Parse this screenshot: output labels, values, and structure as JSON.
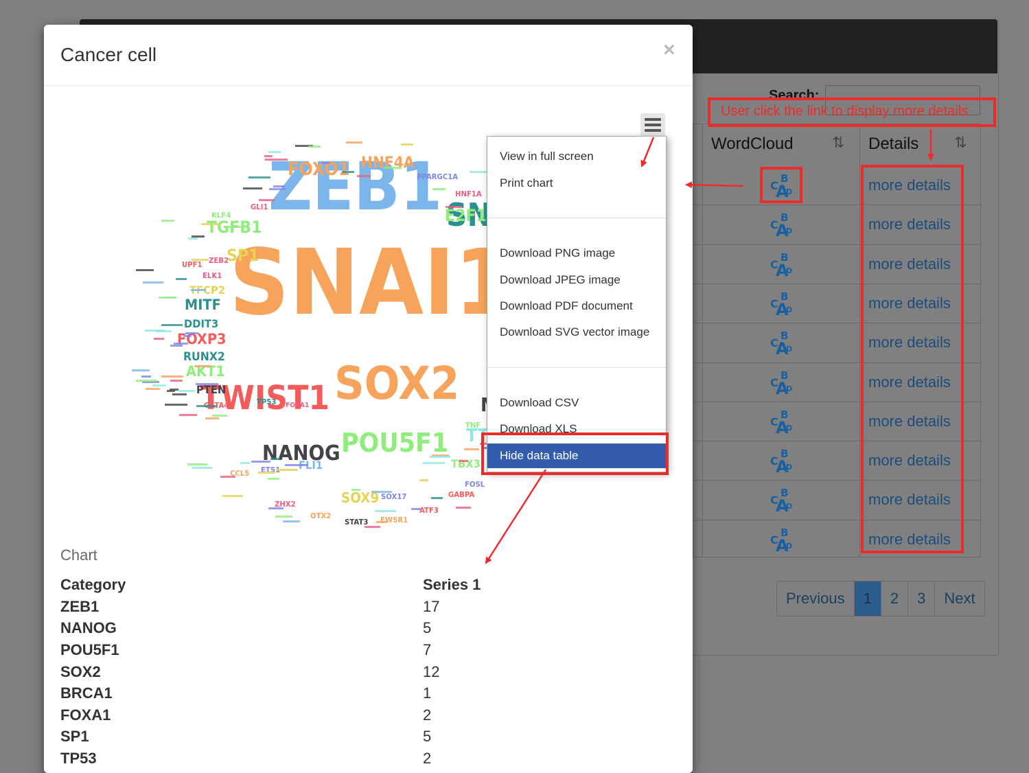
{
  "background": {
    "search_label": "Search:",
    "table": {
      "headers": [
        "WordCloud",
        "Details"
      ],
      "sort_icon": "⇅",
      "rows": [
        {
          "details": "more details"
        },
        {
          "details": "more details"
        },
        {
          "details": "more details"
        },
        {
          "details": "more details"
        },
        {
          "details": "more details"
        },
        {
          "details": "more details"
        },
        {
          "details": "more details"
        },
        {
          "details": "more details"
        },
        {
          "details": "more details"
        },
        {
          "details": "more details"
        }
      ]
    },
    "pagination": [
      "Previous",
      "1",
      "2",
      "3",
      "Next"
    ],
    "active_page": "1"
  },
  "modal": {
    "title": "Cancer cell",
    "close": "×",
    "chart_caption": "Chart",
    "table_headers": [
      "Category",
      "Series 1"
    ],
    "table_rows": [
      [
        "ZEB1",
        "17"
      ],
      [
        "NANOG",
        "5"
      ],
      [
        "POU5F1",
        "7"
      ],
      [
        "SOX2",
        "12"
      ],
      [
        "BRCA1",
        "1"
      ],
      [
        "FOXA1",
        "2"
      ],
      [
        "SP1",
        "5"
      ],
      [
        "TP53",
        "2"
      ]
    ]
  },
  "menu": {
    "items": [
      "View in full screen",
      "Print chart",
      "Download PNG image",
      "Download JPEG image",
      "Download PDF document",
      "Download SVG vector image",
      "Download CSV",
      "Download XLS",
      "Hide data table"
    ]
  },
  "annotation": "User click the link to display more details",
  "colors": {
    "accent_blue": "#7cb5ec",
    "orange": "#f7a35c",
    "red": "#f15c80",
    "green": "#90ed7d",
    "teal": "#2b908f",
    "highlight": "#335cad",
    "annotation_red": "#ee2b2b"
  },
  "chart_data": {
    "type": "wordcloud",
    "words": [
      {
        "text": "SNAI1",
        "color": "#f7a35c"
      },
      {
        "text": "ZEB1",
        "color": "#7cb5ec"
      },
      {
        "text": "SOX2",
        "color": "#f7a35c"
      },
      {
        "text": "TWIST1",
        "color": "#f45b5b"
      },
      {
        "text": "POU5F1",
        "color": "#90ed7d"
      },
      {
        "text": "SN",
        "color": "#2b908f"
      },
      {
        "text": "NANOG",
        "color": "#434348"
      },
      {
        "text": "FOXO1",
        "color": "#f7a35c"
      },
      {
        "text": "HNF4A",
        "color": "#f7a35c"
      },
      {
        "text": "TGFB1",
        "color": "#90ed7d"
      },
      {
        "text": "E2F1",
        "color": "#90ed7d"
      },
      {
        "text": "MITF",
        "color": "#2b908f"
      },
      {
        "text": "FOXP3",
        "color": "#f45b5b"
      },
      {
        "text": "SP1",
        "color": "#e4d354"
      },
      {
        "text": "AKT1",
        "color": "#90ed7d"
      },
      {
        "text": "RUNX2",
        "color": "#2b908f"
      },
      {
        "text": "DDIT3",
        "color": "#2b908f"
      },
      {
        "text": "TFCP2",
        "color": "#e4d354"
      },
      {
        "text": "SOX9",
        "color": "#e4d354"
      },
      {
        "text": "PTEN",
        "color": "#434348"
      },
      {
        "text": "FLI1",
        "color": "#7cb5ec"
      },
      {
        "text": "TBX3",
        "color": "#90ed7d"
      },
      {
        "text": "TT",
        "color": "#91e8e1"
      },
      {
        "text": "M",
        "color": "#434348"
      },
      {
        "text": "PPARGC1A",
        "color": "#8085e9"
      },
      {
        "text": "HNF1A",
        "color": "#f15c80"
      },
      {
        "text": "KLF4",
        "color": "#90ed7d"
      },
      {
        "text": "GLI1",
        "color": "#f15c80"
      },
      {
        "text": "ELK1",
        "color": "#f15c80"
      },
      {
        "text": "UPF1",
        "color": "#f45b5b"
      },
      {
        "text": "ZEB2",
        "color": "#f15c80"
      },
      {
        "text": "GATA4",
        "color": "#f45b5b"
      },
      {
        "text": "TP53",
        "color": "#2b908f"
      },
      {
        "text": "FOXA1",
        "color": "#f15c80"
      },
      {
        "text": "TNF",
        "color": "#90ed7d"
      },
      {
        "text": "FOSL",
        "color": "#8085e9"
      },
      {
        "text": "GABPA",
        "color": "#f45b5b"
      },
      {
        "text": "CCL5",
        "color": "#f7a35c"
      },
      {
        "text": "ETS1",
        "color": "#8085e9"
      },
      {
        "text": "ZHX2",
        "color": "#f15c80"
      },
      {
        "text": "SOX17",
        "color": "#8085e9"
      },
      {
        "text": "OTX2",
        "color": "#f7a35c"
      },
      {
        "text": "STAT3",
        "color": "#434348"
      },
      {
        "text": "EWSR1",
        "color": "#f7a35c"
      },
      {
        "text": "ATF3",
        "color": "#f45b5b"
      }
    ]
  }
}
